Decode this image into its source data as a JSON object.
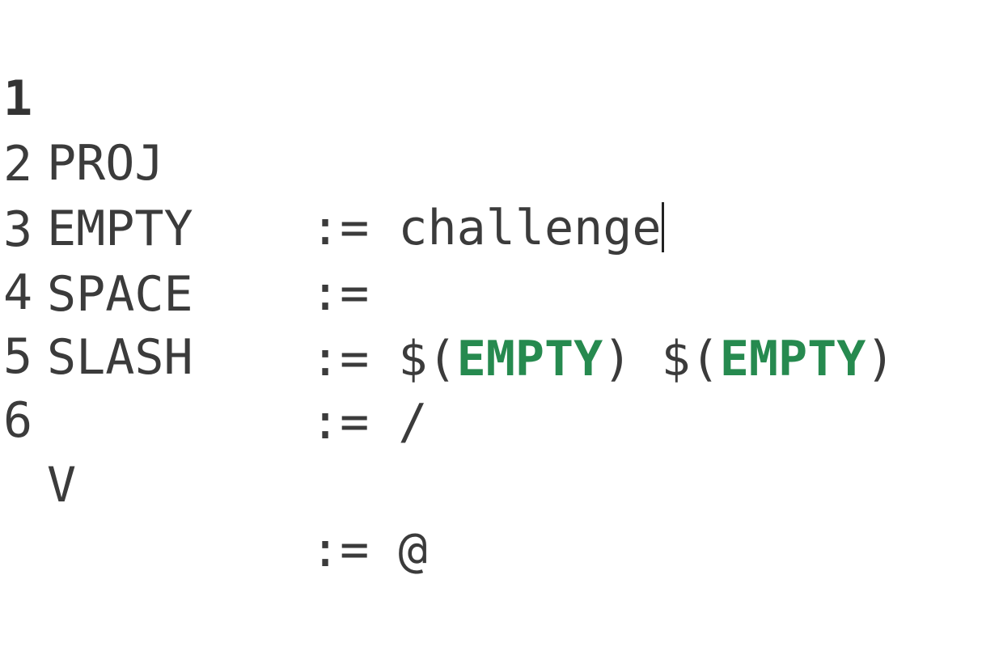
{
  "editor": {
    "lines": [
      {
        "number": "1",
        "name": "PROJ",
        "op": ":=",
        "value": "challenge"
      },
      {
        "number": "2",
        "name": "EMPTY",
        "op": ":=",
        "value": ""
      },
      {
        "number": "3",
        "name": "SPACE",
        "op": ":=",
        "ref1_open": "$(",
        "ref1_var": "EMPTY",
        "ref1_close": ")",
        "ref2_open": "$(",
        "ref2_var": "EMPTY",
        "ref2_close": ")"
      },
      {
        "number": "4",
        "name": "SLASH",
        "op": ":=",
        "value": "/"
      },
      {
        "number": "5",
        "name": "",
        "op": "",
        "value": ""
      },
      {
        "number": "6",
        "name": "V",
        "op": ":=",
        "value": "@"
      }
    ],
    "colors": {
      "text": "#3b3b3b",
      "variable": "#268a4f",
      "background": "#ffffff"
    }
  }
}
